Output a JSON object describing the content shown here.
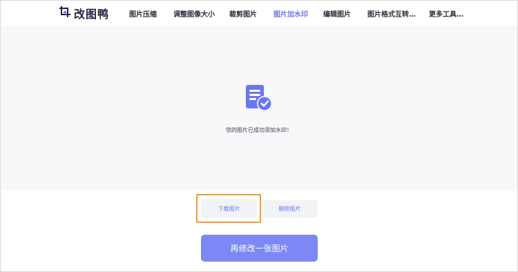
{
  "header": {
    "logo_text": "改图鸭",
    "nav": [
      {
        "label": "图片压缩"
      },
      {
        "label": "调整图像大小"
      },
      {
        "label": "裁剪图片"
      },
      {
        "label": "图片加水印",
        "active": true
      },
      {
        "label": "编辑图片"
      },
      {
        "label": "图片格式互转…"
      },
      {
        "label": "更多工具…"
      }
    ]
  },
  "result": {
    "icon": "document-check-icon",
    "message": "您的图片已成功添加水印！"
  },
  "actions": {
    "download_label": "下载图片",
    "delete_label": "删除图片",
    "remodify_label": "再修改一张图片"
  },
  "colors": {
    "accent": "#6b76f2",
    "primary_button": "#7c88f4",
    "highlight_border": "#f39a2b",
    "content_bg": "#f7f8fa"
  }
}
